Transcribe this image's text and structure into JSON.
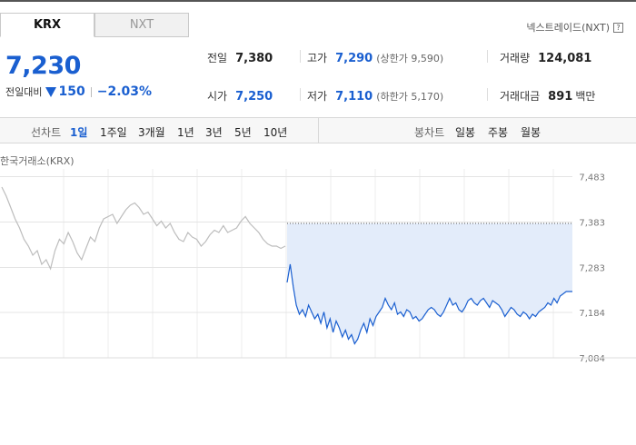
{
  "tabs": [
    {
      "label": "KRX",
      "active": true
    },
    {
      "label": "NXT",
      "active": false
    }
  ],
  "nxt_link": "넥스트레이드(NXT)",
  "price": "7,230",
  "change": {
    "label": "전일대비",
    "amount": "150",
    "rate": "−2.03%",
    "direction": "down"
  },
  "stats": {
    "prev_close": {
      "label": "전일",
      "value": "7,380"
    },
    "high": {
      "label": "고가",
      "value": "7,290",
      "sub": "(상한가 9,590)"
    },
    "volume": {
      "label": "거래량",
      "value": "124,081"
    },
    "open": {
      "label": "시가",
      "value": "7,250"
    },
    "low": {
      "label": "저가",
      "value": "7,110",
      "sub": "(하한가 5,170)"
    },
    "trade_value": {
      "label": "거래대금",
      "value": "891",
      "unit": "백만"
    }
  },
  "toolbar": {
    "line_label": "선차트",
    "periods": [
      "1일",
      "1주일",
      "3개월",
      "1년",
      "3년",
      "5년",
      "10년"
    ],
    "selected_period": "1일",
    "candle_label": "봉차트",
    "candles": [
      "일봉",
      "주봉",
      "월봉"
    ]
  },
  "market_label": "한국거래소(KRX)",
  "colors": {
    "accent": "#1a5fd0",
    "down": "#1a5fd0",
    "prev_series": "#bdbdbd",
    "fill": "#e3ecfa"
  },
  "chart_data": {
    "type": "line",
    "title": "",
    "xlabel": "",
    "ylabel": "",
    "yticks": [
      7084,
      7184,
      7283,
      7383,
      7483
    ],
    "ytick_labels": [
      "7,084",
      "7,184",
      "7,283",
      "7,383",
      "7,483"
    ],
    "ylim": [
      7084,
      7500
    ],
    "reference_line": {
      "value": 7380
    },
    "grid": true,
    "series": [
      {
        "values": [
          7460,
          7440,
          7415,
          7390,
          7370,
          7345,
          7330,
          7310,
          7320,
          7290,
          7300,
          7280,
          7320,
          7345,
          7335,
          7360,
          7340,
          7315,
          7300,
          7325,
          7350,
          7340,
          7370,
          7390,
          7395,
          7400,
          7380,
          7395,
          7410,
          7420,
          7425,
          7415,
          7400,
          7405,
          7390,
          7375,
          7385,
          7370,
          7380,
          7360,
          7345,
          7340,
          7360,
          7350,
          7345,
          7330,
          7340,
          7355,
          7365,
          7360,
          7375,
          7360,
          7365,
          7370,
          7385,
          7395,
          7380,
          7370,
          7360,
          7345,
          7335,
          7330,
          7330,
          7325,
          7330
        ]
      },
      {
        "values": [
          7250,
          7290,
          7240,
          7200,
          7180,
          7190,
          7175,
          7200,
          7185,
          7170,
          7180,
          7160,
          7185,
          7150,
          7170,
          7140,
          7165,
          7150,
          7130,
          7145,
          7125,
          7135,
          7115,
          7125,
          7145,
          7160,
          7140,
          7170,
          7155,
          7175,
          7185,
          7195,
          7215,
          7200,
          7190,
          7205,
          7180,
          7185,
          7175,
          7190,
          7185,
          7170,
          7175,
          7165,
          7170,
          7180,
          7190,
          7195,
          7190,
          7180,
          7175,
          7185,
          7200,
          7215,
          7200,
          7205,
          7190,
          7185,
          7195,
          7210,
          7215,
          7205,
          7200,
          7210,
          7215,
          7205,
          7195,
          7210,
          7205,
          7200,
          7190,
          7175,
          7185,
          7195,
          7190,
          7180,
          7175,
          7185,
          7180,
          7170,
          7180,
          7175,
          7185,
          7190,
          7195,
          7205,
          7200,
          7215,
          7205,
          7220,
          7225,
          7230,
          7230,
          7230
        ]
      }
    ]
  }
}
